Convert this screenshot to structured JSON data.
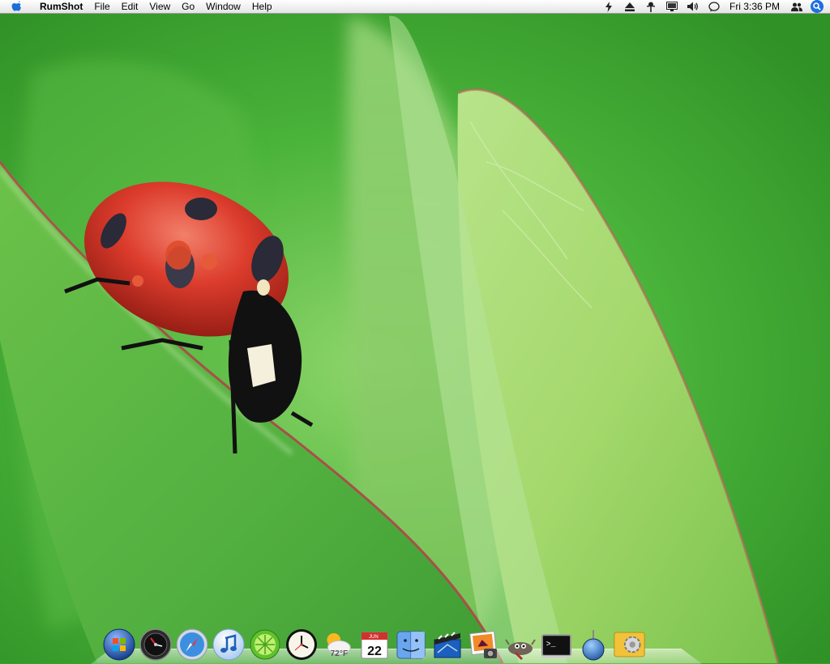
{
  "menubar": {
    "app_name": "RumShot",
    "menus": [
      "File",
      "Edit",
      "View",
      "Go",
      "Window",
      "Help"
    ],
    "clock": "Fri 3:36 PM",
    "status_icons": [
      "bolt-icon",
      "eject-icon",
      "network-icon",
      "display-icon",
      "volume-icon",
      "chat-icon",
      "users-icon",
      "spotlight-icon"
    ]
  },
  "desktop": {
    "wallpaper": "ladybug-on-leaf"
  },
  "dock": {
    "items": [
      {
        "name": "windows-start-icon"
      },
      {
        "name": "dashboard-icon"
      },
      {
        "name": "safari-icon"
      },
      {
        "name": "itunes-icon"
      },
      {
        "name": "limewire-icon"
      },
      {
        "name": "clock-icon"
      },
      {
        "name": "weather-icon",
        "label": "72°F"
      },
      {
        "name": "ical-icon",
        "month": "JUN",
        "day": "22"
      },
      {
        "name": "finder-icon"
      },
      {
        "name": "imovie-icon"
      },
      {
        "name": "iphoto-icon"
      },
      {
        "name": "gimp-icon"
      },
      {
        "name": "terminal-icon",
        "label": ">_"
      },
      {
        "name": "network-globe-icon"
      },
      {
        "name": "system-preferences-icon"
      }
    ]
  },
  "colors": {
    "wallpaper_green": "#3aa02a",
    "ladybug_red": "#d83a2a",
    "menubar": "#f0f0f0"
  }
}
